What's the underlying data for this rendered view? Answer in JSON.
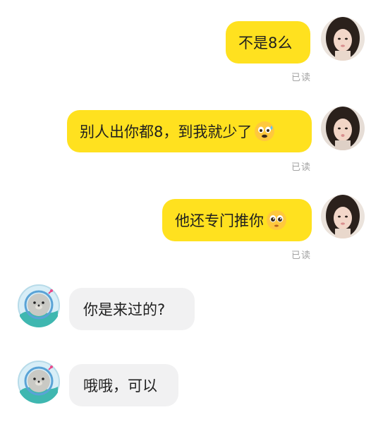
{
  "messages": [
    {
      "side": "right",
      "text": "不是8么",
      "read": "已读"
    },
    {
      "side": "right",
      "text": "别人出你都8，到我就少了",
      "read": "已读",
      "emoji": "anxious-sweat-emoji"
    },
    {
      "side": "right",
      "text": "他还专门推你",
      "read": "已读",
      "emoji": "pleading-face-emoji"
    },
    {
      "side": "left",
      "text": "你是来过的?"
    },
    {
      "side": "left",
      "text": "哦哦，可以"
    }
  ],
  "colors": {
    "my_bubble": "#ffe11f",
    "their_bubble": "#f1f1f2",
    "read_receipt": "#a3a3a3"
  },
  "icons": {
    "my_avatar": "girl-photo-avatar",
    "their_avatar": "seal-astronaut-avatar"
  }
}
